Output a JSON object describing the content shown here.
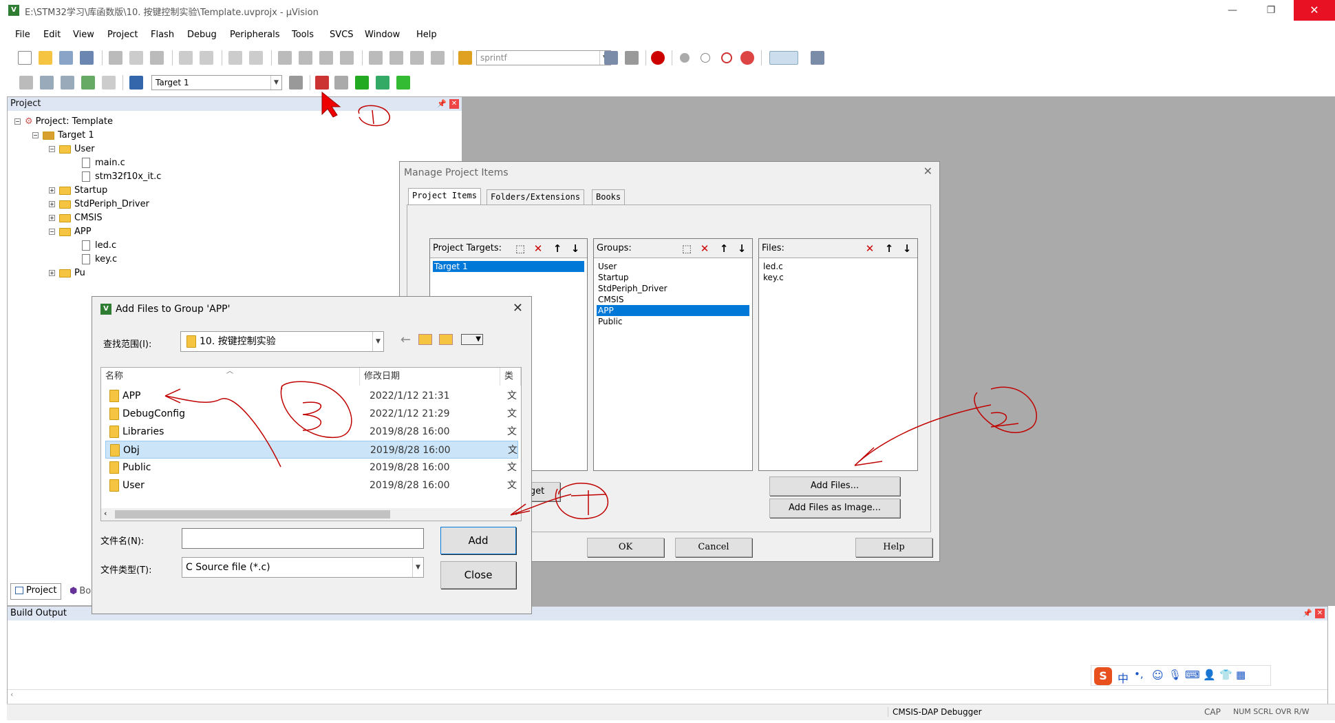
{
  "titlebar": {
    "title": "E:\\STM32学习\\库函数版\\10. 按键控制实验\\Template.uvprojx - µVision",
    "app_icon": "V"
  },
  "window_controls": {
    "minimize": "—",
    "restore": "❐",
    "close": "✕"
  },
  "menu": [
    "File",
    "Edit",
    "View",
    "Project",
    "Flash",
    "Debug",
    "Peripherals",
    "Tools",
    "SVCS",
    "Window",
    "Help"
  ],
  "toolbar": {
    "find_combo": "sprintf",
    "target_combo": "Target 1"
  },
  "project_panel": {
    "title": "Project",
    "tree": [
      "Project: Template",
      "Target 1",
      "User",
      "main.c",
      "stm32f10x_it.c",
      "Startup",
      "StdPeriph_Driver",
      "CMSIS",
      "APP",
      "led.c",
      "key.c",
      "Pu"
    ],
    "tabs": [
      "Project",
      "Bo"
    ]
  },
  "build_output": {
    "title": "Build Output"
  },
  "statusbar": {
    "debugger": "CMSIS-DAP Debugger",
    "caps": "CAP",
    "extra": "NUM SCRL OVR R/W"
  },
  "manage_dialog": {
    "title": "Manage Project Items",
    "tabs": [
      "Project Items",
      "Folders/Extensions",
      "Books"
    ],
    "targets_header": "Project Targets:",
    "targets": [
      "Target 1"
    ],
    "groups_header": "Groups:",
    "groups": [
      "User",
      "Startup",
      "StdPeriph_Driver",
      "CMSIS",
      "APP",
      "Public"
    ],
    "files_header": "Files:",
    "files": [
      "led.c",
      "key.c"
    ],
    "set_target_btn": "rget",
    "add_files_btn": "Add Files...",
    "add_files_image_btn": "Add Files as Image...",
    "ok_btn": "OK",
    "cancel_btn": "Cancel",
    "help_btn": "Help"
  },
  "add_dialog": {
    "title": "Add Files to Group 'APP'",
    "look_in_label": "查找范围(I):",
    "look_in_value": "10. 按键控制实验",
    "col_name": "名称",
    "col_date": "修改日期",
    "col_type": "类",
    "rows": [
      {
        "name": "APP",
        "date": "2022/1/12 21:31",
        "type": "文"
      },
      {
        "name": "DebugConfig",
        "date": "2022/1/12 21:29",
        "type": "文"
      },
      {
        "name": "Libraries",
        "date": "2019/8/28 16:00",
        "type": "文"
      },
      {
        "name": "Obj",
        "date": "2019/8/28 16:00",
        "type": "文"
      },
      {
        "name": "Public",
        "date": "2019/8/28 16:00",
        "type": "文"
      },
      {
        "name": "User",
        "date": "2019/8/28 16:00",
        "type": "文"
      }
    ],
    "filename_label": "文件名(N):",
    "filename_value": "",
    "filetype_label": "文件类型(T):",
    "filetype_value": "C Source file (*.c)",
    "add_btn": "Add",
    "close_btn": "Close"
  },
  "ime": {
    "chinese": "中",
    "punct": "•,"
  },
  "colors": {
    "accent": "#0078d7",
    "annotation": "#c00000"
  }
}
